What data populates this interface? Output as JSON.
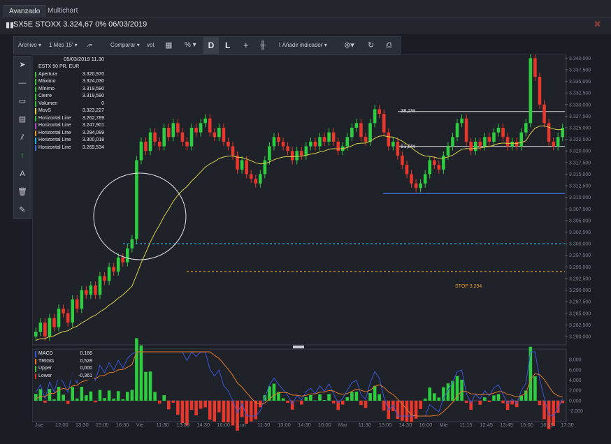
{
  "tabs": [
    {
      "label": "Avanzado",
      "active": true
    },
    {
      "label": "Multichart",
      "active": false
    }
  ],
  "header": {
    "title": "SX5E STOXX 3.324,67 0% 06/03/2019"
  },
  "toolbar": {
    "archivo": "Archivo",
    "period": "1 Mes 15'",
    "comparar": "Comparar",
    "vol": "vol.",
    "percent": "%",
    "d": "D",
    "l": "L",
    "add_indicator": "Añadir indicador"
  },
  "info": {
    "date": "05/03/2019 11.30",
    "instrument": "ESTX 50 PR. EUR",
    "rows": [
      {
        "label": "Apertura",
        "value": "3.320,970",
        "color": "#3fbf3f"
      },
      {
        "label": "Máximo",
        "value": "3.324,030",
        "color": "#3fbf3f"
      },
      {
        "label": "Mínimo",
        "value": "3.319,590",
        "color": "#3fbf3f"
      },
      {
        "label": "Cierre",
        "value": "3.319,590",
        "color": "#3fbf3f"
      },
      {
        "label": "Volumen",
        "value": "0",
        "color": "#3fbf3f"
      },
      {
        "label": "MovS",
        "value": "3.323,227",
        "color": "#e0d24a"
      },
      {
        "label": "Horizontal Line",
        "value": "3.262,789",
        "color": "#3fbf3f"
      },
      {
        "label": "Horizontal Line",
        "value": "3.247,901",
        "color": "#b04ac4"
      },
      {
        "label": "Horizontal Line",
        "value": "3.294,099",
        "color": "#e39a2a"
      },
      {
        "label": "Horizontal Line",
        "value": "3.300,018",
        "color": "#2ab0e3"
      },
      {
        "label": "Horizontal Line",
        "value": "3.269,534",
        "color": "#3d6fd6"
      }
    ]
  },
  "macd_info": {
    "rows": [
      {
        "label": "MACD",
        "value": "0,166",
        "color": "#3a55d6"
      },
      {
        "label": "TRIGG",
        "value": "0,528",
        "color": "#e27a2a"
      },
      {
        "label": "Upper",
        "value": "0,000",
        "color": "#3fbf3f"
      },
      {
        "label": "Lower",
        "value": "-0,361",
        "color": "#d93030"
      }
    ]
  },
  "annotations": {
    "fib_382": "38,2%",
    "fib_618": "61,8%",
    "stop": "STOP 3.294"
  },
  "chart_data": {
    "type": "candlestick",
    "y_ticks": [
      "3.340,000",
      "3.337,500",
      "3.335,000",
      "3.332,500",
      "3.330,000",
      "3.327,500",
      "3.325,000",
      "3.322,500",
      "3.320,000",
      "3.317,500",
      "3.315,000",
      "3.312,500",
      "3.310,000",
      "3.307,500",
      "3.305,000",
      "3.302,500",
      "3.300,000",
      "3.297,500",
      "3.295,000",
      "3.292,500",
      "3.290,000",
      "3.287,500",
      "3.285,000",
      "3.282,500",
      "3.280,000"
    ],
    "ylim": [
      3278.5,
      3340.5
    ],
    "x_labels": [
      "Jue",
      "12:00",
      "13:30",
      "15:00",
      "16:30",
      "Vie",
      "11:30",
      "13:00",
      "14:30",
      "16:00",
      "Lun",
      "11:30",
      "13:00",
      "14:30",
      "16:00",
      "Mar",
      "11:30",
      "13:00",
      "14:30",
      "16:00",
      "Mie",
      "11:15",
      "12:45",
      "13:45",
      "15:00",
      "16:15",
      "17:30"
    ],
    "closes": [
      3281,
      3283,
      3280,
      3284,
      3282,
      3286,
      3285,
      3283,
      3288,
      3286,
      3290,
      3289,
      3291,
      3289,
      3293,
      3292,
      3295,
      3294,
      3297,
      3296,
      3299,
      3301,
      3318,
      3322,
      3320,
      3324,
      3322,
      3321,
      3325,
      3323,
      3326,
      3324,
      3322,
      3321,
      3325,
      3324,
      3326,
      3327,
      3324,
      3323,
      3325,
      3322,
      3321,
      3319,
      3316,
      3318,
      3315,
      3314,
      3313,
      3315,
      3318,
      3321,
      3323,
      3322,
      3321,
      3320,
      3318,
      3320,
      3319,
      3321,
      3322,
      3321,
      3323,
      3322,
      3324,
      3322,
      3320,
      3321,
      3323,
      3325,
      3326,
      3323,
      3322,
      3326,
      3329,
      3328,
      3324,
      3321,
      3322,
      3319,
      3317,
      3315,
      3313,
      3312,
      3313,
      3315,
      3318,
      3317,
      3316,
      3319,
      3321,
      3323,
      3326,
      3327,
      3322,
      3320,
      3322,
      3321,
      3323,
      3322,
      3324,
      3325,
      3323,
      3321,
      3322,
      3321,
      3324,
      3326,
      3340,
      3336,
      3330,
      3326,
      3322,
      3321,
      3323,
      3325
    ],
    "moving_average": "yellow line (MovS)",
    "horizontal_lines": [
      {
        "label": "38,2%",
        "value": 3328.5
      },
      {
        "label": "61,8%",
        "value": 3321.0
      },
      {
        "value": 3310.8
      },
      {
        "value": 3300.0
      },
      {
        "label": "STOP 3.294",
        "value": 3294.0
      }
    ],
    "macd": {
      "y_ticks": [
        "8,000",
        "6,000",
        "4,000",
        "2,000",
        "0,000",
        "-2,000"
      ],
      "ylim": [
        -3,
        9.5
      ],
      "series": [
        "MACD",
        "TRIGG",
        "histogram"
      ]
    }
  }
}
